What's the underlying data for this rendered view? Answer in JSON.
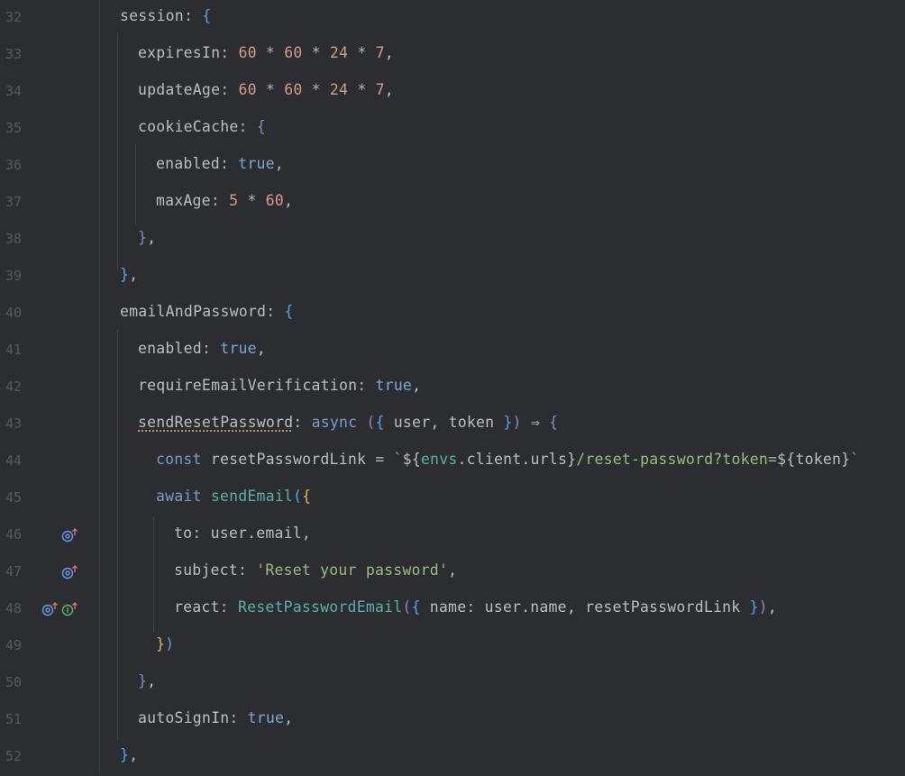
{
  "editor": {
    "lines": [
      {
        "num": "32",
        "code": "session: {"
      },
      {
        "num": "33",
        "code": "expiresIn: 60 * 60 * 24 * 7,"
      },
      {
        "num": "34",
        "code": "updateAge: 60 * 60 * 24 * 7,"
      },
      {
        "num": "35",
        "code": "cookieCache: {"
      },
      {
        "num": "36",
        "code": "enabled: true,"
      },
      {
        "num": "37",
        "code": "maxAge: 5 * 60,"
      },
      {
        "num": "38",
        "code": "},"
      },
      {
        "num": "39",
        "code": "},"
      },
      {
        "num": "40",
        "code": "emailAndPassword: {"
      },
      {
        "num": "41",
        "code": "enabled: true,"
      },
      {
        "num": "42",
        "code": "requireEmailVerification: true,"
      },
      {
        "num": "43",
        "code": "sendResetPassword: async ({ user, token }) ⇒ {"
      },
      {
        "num": "44",
        "code": "const resetPasswordLink = `${envs.client.urls}/reset-password?token=${token}`"
      },
      {
        "num": "45",
        "code": "await sendEmail({"
      },
      {
        "num": "46",
        "code": "to: user.email,"
      },
      {
        "num": "47",
        "code": "subject: 'Reset your password',"
      },
      {
        "num": "48",
        "code": "react: ResetPasswordEmail({ name: user.name, resetPasswordLink }),"
      },
      {
        "num": "49",
        "code": "})"
      },
      {
        "num": "50",
        "code": "},"
      },
      {
        "num": "51",
        "code": "autoSignIn: true,"
      },
      {
        "num": "52",
        "code": "},"
      }
    ],
    "gutter_icons": {
      "46": [
        "implementation-up-icon"
      ],
      "47": [
        "implementation-up-icon"
      ],
      "48": [
        "implementation-up-icon",
        "interface-up-icon"
      ]
    }
  },
  "colors": {
    "background": "#2b2d30",
    "line_number": "#555a61",
    "text": "#bcbec4",
    "keyword": "#7a9cc6",
    "number": "#d19d8a",
    "string": "#9fba80",
    "function": "#57aaf7"
  }
}
